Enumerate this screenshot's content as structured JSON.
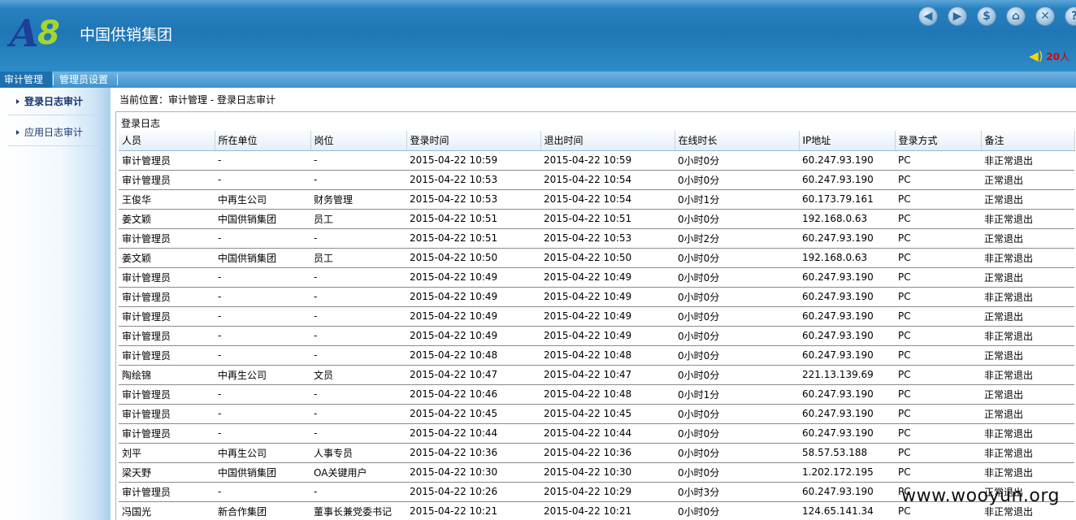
{
  "header": {
    "logo_text_a": "A",
    "logo_text_8": "8",
    "company_name": "中国供销集团",
    "buttons": [
      "back-icon",
      "forward-icon",
      "switch-icon",
      "home-icon",
      "close-icon",
      "help-icon"
    ],
    "online_count": "20",
    "online_unit": "人"
  },
  "nav": {
    "tabs": [
      {
        "label": "审计管理",
        "active": true
      },
      {
        "label": "管理员设置",
        "active": false
      }
    ]
  },
  "sidebar": {
    "items": [
      {
        "label": "登录日志审计",
        "active": true
      },
      {
        "label": "应用日志审计",
        "active": false
      }
    ]
  },
  "breadcrumb": {
    "prefix": "当前位置：",
    "path": "审计管理 - 登录日志审计"
  },
  "panel": {
    "title": "登录日志",
    "columns": [
      "人员",
      "所在单位",
      "岗位",
      "登录时间",
      "退出时间",
      "在线时长",
      "IP地址",
      "登录方式",
      "备注"
    ],
    "rows": [
      [
        "审计管理员",
        "-",
        "-",
        "2015-04-22 10:59",
        "2015-04-22 10:59",
        "0小时0分",
        "60.247.93.190",
        "PC",
        "非正常退出"
      ],
      [
        "审计管理员",
        "-",
        "-",
        "2015-04-22 10:53",
        "2015-04-22 10:54",
        "0小时0分",
        "60.247.93.190",
        "PC",
        "正常退出"
      ],
      [
        "王俊华",
        "中再生公司",
        "财务管理",
        "2015-04-22 10:53",
        "2015-04-22 10:54",
        "0小时1分",
        "60.173.79.161",
        "PC",
        "正常退出"
      ],
      [
        "姜文颖",
        "中国供销集团",
        "员工",
        "2015-04-22 10:51",
        "2015-04-22 10:51",
        "0小时0分",
        "192.168.0.63",
        "PC",
        "非正常退出"
      ],
      [
        "审计管理员",
        "-",
        "-",
        "2015-04-22 10:51",
        "2015-04-22 10:53",
        "0小时2分",
        "60.247.93.190",
        "PC",
        "正常退出"
      ],
      [
        "姜文颖",
        "中国供销集团",
        "员工",
        "2015-04-22 10:50",
        "2015-04-22 10:50",
        "0小时0分",
        "192.168.0.63",
        "PC",
        "非正常退出"
      ],
      [
        "审计管理员",
        "-",
        "-",
        "2015-04-22 10:49",
        "2015-04-22 10:49",
        "0小时0分",
        "60.247.93.190",
        "PC",
        "正常退出"
      ],
      [
        "审计管理员",
        "-",
        "-",
        "2015-04-22 10:49",
        "2015-04-22 10:49",
        "0小时0分",
        "60.247.93.190",
        "PC",
        "非正常退出"
      ],
      [
        "审计管理员",
        "-",
        "-",
        "2015-04-22 10:49",
        "2015-04-22 10:49",
        "0小时0分",
        "60.247.93.190",
        "PC",
        "正常退出"
      ],
      [
        "审计管理员",
        "-",
        "-",
        "2015-04-22 10:49",
        "2015-04-22 10:49",
        "0小时0分",
        "60.247.93.190",
        "PC",
        "非正常退出"
      ],
      [
        "审计管理员",
        "-",
        "-",
        "2015-04-22 10:48",
        "2015-04-22 10:48",
        "0小时0分",
        "60.247.93.190",
        "PC",
        "正常退出"
      ],
      [
        "陶绘锦",
        "中再生公司",
        "文员",
        "2015-04-22 10:47",
        "2015-04-22 10:47",
        "0小时0分",
        "221.13.139.69",
        "PC",
        "非正常退出"
      ],
      [
        "审计管理员",
        "-",
        "-",
        "2015-04-22 10:46",
        "2015-04-22 10:48",
        "0小时1分",
        "60.247.93.190",
        "PC",
        "正常退出"
      ],
      [
        "审计管理员",
        "-",
        "-",
        "2015-04-22 10:45",
        "2015-04-22 10:45",
        "0小时0分",
        "60.247.93.190",
        "PC",
        "正常退出"
      ],
      [
        "审计管理员",
        "-",
        "-",
        "2015-04-22 10:44",
        "2015-04-22 10:44",
        "0小时0分",
        "60.247.93.190",
        "PC",
        "非正常退出"
      ],
      [
        "刘平",
        "中再生公司",
        "人事专员",
        "2015-04-22 10:36",
        "2015-04-22 10:36",
        "0小时0分",
        "58.57.53.188",
        "PC",
        "非正常退出"
      ],
      [
        "梁天野",
        "中国供销集团",
        "OA关键用户",
        "2015-04-22 10:30",
        "2015-04-22 10:30",
        "0小时0分",
        "1.202.172.195",
        "PC",
        "非正常退出"
      ],
      [
        "审计管理员",
        "-",
        "-",
        "2015-04-22 10:26",
        "2015-04-22 10:29",
        "0小时3分",
        "60.247.93.190",
        "PC",
        "正常退出"
      ],
      [
        "冯国光",
        "新合作集团",
        "董事长兼党委书记",
        "2015-04-22 10:21",
        "2015-04-22 10:21",
        "0小时0分",
        "124.65.141.34",
        "PC",
        "非正常退出"
      ]
    ]
  },
  "watermark": "www.wooyun.org"
}
